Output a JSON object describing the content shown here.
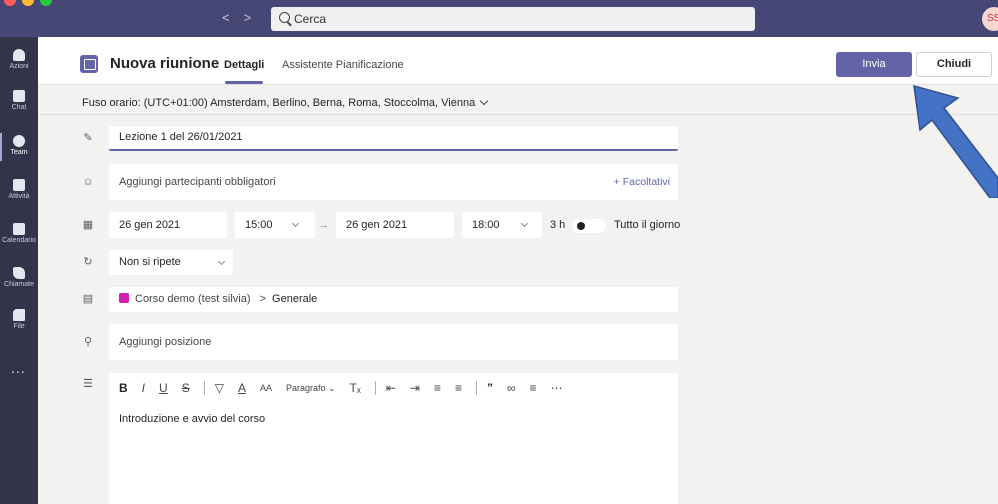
{
  "search": {
    "placeholder": "Cerca"
  },
  "avatar": {
    "initials": "SS"
  },
  "rail": {
    "items": [
      {
        "label": "Azioni",
        "icon": "bell-icon"
      },
      {
        "label": "Chat",
        "icon": "chat-icon"
      },
      {
        "label": "Team",
        "icon": "team-icon",
        "active": true
      },
      {
        "label": "Attività",
        "icon": "assignment-icon"
      },
      {
        "label": "Calendario",
        "icon": "calendar-icon"
      },
      {
        "label": "Chiamate",
        "icon": "phone-icon"
      },
      {
        "label": "File",
        "icon": "file-icon"
      }
    ],
    "more": "..."
  },
  "header": {
    "title": "Nuova riunione",
    "tab_details": "Dettagli",
    "tab_assistant": "Assistente Pianificazione",
    "send": "Invia",
    "close": "Chiudi"
  },
  "timezone": "Fuso orario: (UTC+01:00) Amsterdam, Berlino, Berna, Roma, Stoccolma, Vienna",
  "form": {
    "title": "Lezione 1 del 26/01/2021",
    "attendees_placeholder": "Aggiungi partecipanti obbligatori",
    "optional": "+ Facoltativi",
    "start_date": "26 gen 2021",
    "start_time": "15:00",
    "end_date": "26 gen 2021",
    "end_time": "18:00",
    "duration": "3 h",
    "all_day": "Tutto il giorno",
    "all_day_on": true,
    "repeat": "Non si ripete",
    "channel_team": "Corso demo (test silvia)",
    "channel_sep": ">",
    "channel_name": "Generale",
    "location_placeholder": "Aggiungi posizione"
  },
  "editor": {
    "paragraph": "Paragrafo",
    "text": "Introduzione e avvio del corso"
  },
  "colors": {
    "accent": "#6264a7",
    "annotation_arrow": "#4472c4",
    "channel_square": "#d11fb5"
  }
}
